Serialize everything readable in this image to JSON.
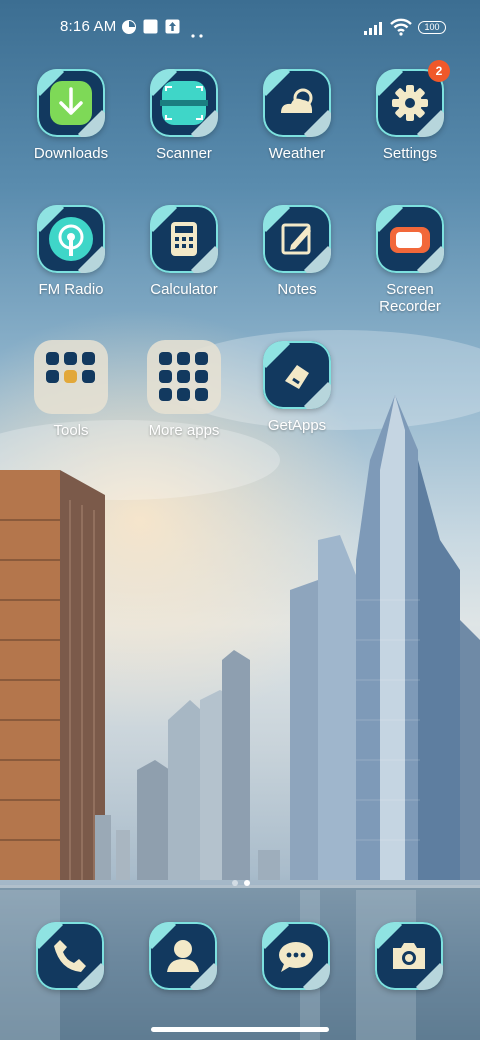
{
  "status_bar": {
    "time": "8:16 AM",
    "battery": "100",
    "icons": [
      "app-notification-icon",
      "square-notification-icon",
      "upload-notification-icon",
      "more-dots-icon",
      "signal-icon",
      "wifi-icon",
      "battery-icon"
    ]
  },
  "apps": [
    {
      "label": "Downloads",
      "icon": "download-icon"
    },
    {
      "label": "Scanner",
      "icon": "scanner-icon"
    },
    {
      "label": "Weather",
      "icon": "weather-icon"
    },
    {
      "label": "Settings",
      "icon": "gear-icon",
      "badge": "2"
    },
    {
      "label": "FM Radio",
      "icon": "radio-icon"
    },
    {
      "label": "Calculator",
      "icon": "calculator-icon"
    },
    {
      "label": "Notes",
      "icon": "notes-icon"
    },
    {
      "label": "Screen Recorder",
      "icon": "screen-recorder-icon"
    },
    {
      "label": "Tools",
      "icon": "folder-icon"
    },
    {
      "label": "More apps",
      "icon": "folder-icon"
    },
    {
      "label": "GetApps",
      "icon": "getapps-icon"
    }
  ],
  "page_indicator": {
    "pages": 2,
    "current": 2
  },
  "dock": [
    {
      "icon": "phone-icon"
    },
    {
      "icon": "contacts-icon"
    },
    {
      "icon": "messages-icon"
    },
    {
      "icon": "camera-icon"
    }
  ],
  "colors": {
    "tile_background": "#12395f",
    "tile_outline": "#7de1df",
    "badge": "#f0582a",
    "downloads_green": "#7ed957",
    "scanner_teal": "#3fd6c8",
    "recorder_orange": "#f2683a",
    "weather_cream": "#f3e9c8"
  }
}
